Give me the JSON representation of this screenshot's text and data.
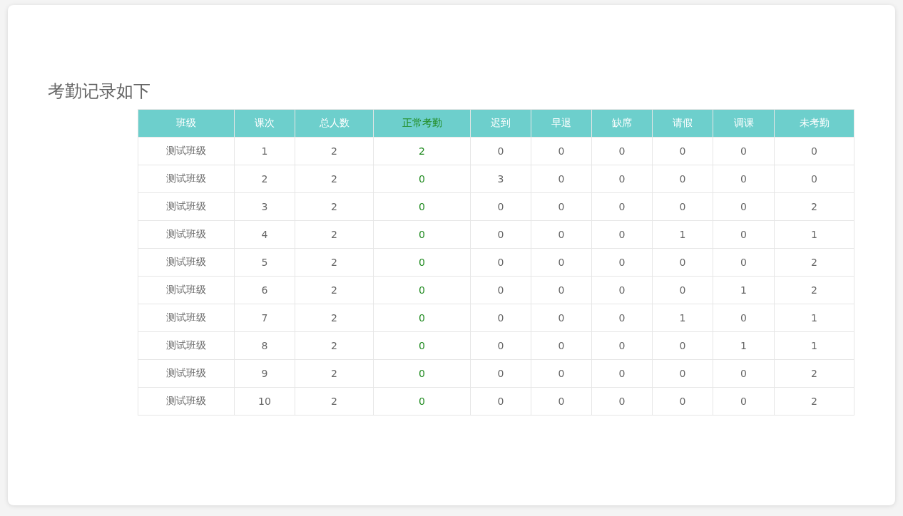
{
  "title": "考勤记录如下",
  "table": {
    "columns": [
      {
        "label": "班级",
        "kind": "plain"
      },
      {
        "label": "课次",
        "kind": "plain"
      },
      {
        "label": "总人数",
        "kind": "plain"
      },
      {
        "label": "正常考勤",
        "kind": "highlight"
      },
      {
        "label": "迟到",
        "kind": "plain"
      },
      {
        "label": "早退",
        "kind": "plain"
      },
      {
        "label": "缺席",
        "kind": "plain"
      },
      {
        "label": "请假",
        "kind": "plain"
      },
      {
        "label": "调课",
        "kind": "plain"
      },
      {
        "label": "未考勤",
        "kind": "plain"
      }
    ],
    "rows": [
      [
        "测试班级",
        "1",
        "2",
        "2",
        "0",
        "0",
        "0",
        "0",
        "0",
        "0"
      ],
      [
        "测试班级",
        "2",
        "2",
        "0",
        "3",
        "0",
        "0",
        "0",
        "0",
        "0"
      ],
      [
        "测试班级",
        "3",
        "2",
        "0",
        "0",
        "0",
        "0",
        "0",
        "0",
        "2"
      ],
      [
        "测试班级",
        "4",
        "2",
        "0",
        "0",
        "0",
        "0",
        "1",
        "0",
        "1"
      ],
      [
        "测试班级",
        "5",
        "2",
        "0",
        "0",
        "0",
        "0",
        "0",
        "0",
        "2"
      ],
      [
        "测试班级",
        "6",
        "2",
        "0",
        "0",
        "0",
        "0",
        "0",
        "1",
        "2"
      ],
      [
        "测试班级",
        "7",
        "2",
        "0",
        "0",
        "0",
        "0",
        "1",
        "0",
        "1"
      ],
      [
        "测试班级",
        "8",
        "2",
        "0",
        "0",
        "0",
        "0",
        "0",
        "1",
        "1"
      ],
      [
        "测试班级",
        "9",
        "2",
        "0",
        "0",
        "0",
        "0",
        "0",
        "0",
        "2"
      ],
      [
        "测试班级",
        "10",
        "2",
        "0",
        "0",
        "0",
        "0",
        "0",
        "0",
        "2"
      ]
    ]
  }
}
